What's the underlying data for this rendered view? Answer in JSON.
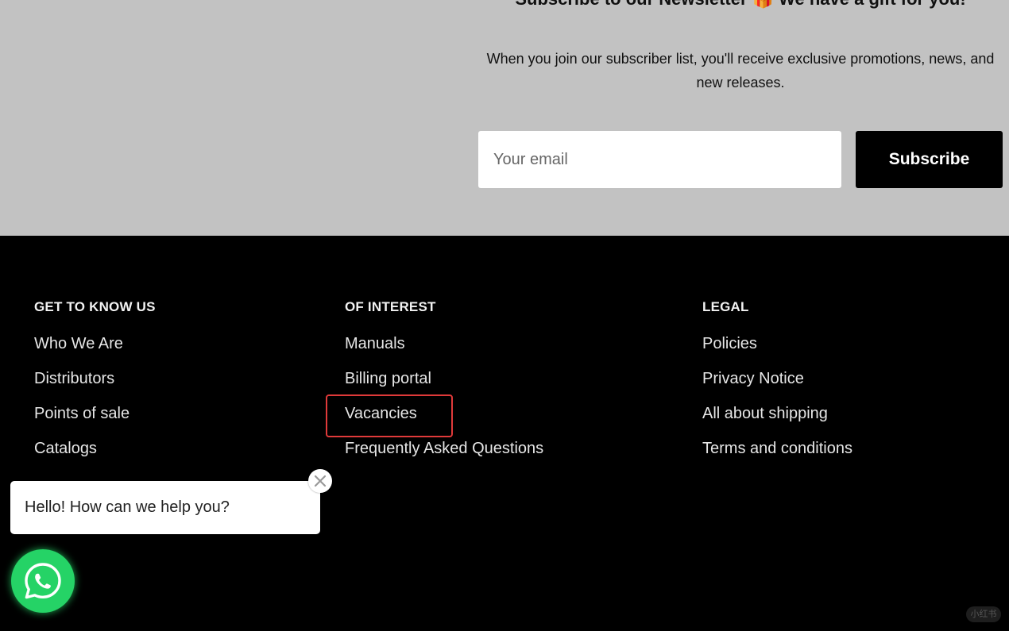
{
  "newsletter": {
    "heading": "Subscribe to our Newsletter 🎁 We have a gift for you!",
    "description": "When you join our subscriber list, you'll receive exclusive promotions, news, and new releases.",
    "email_placeholder": "Your email",
    "subscribe_label": "Subscribe",
    "background_color": "#c2c2c2"
  },
  "footer": {
    "columns": [
      {
        "heading": "GET TO KNOW US",
        "links": [
          "Who We Are",
          "Distributors",
          "Points of sale",
          "Catalogs"
        ]
      },
      {
        "heading": "OF INTEREST",
        "links": [
          "Manuals",
          "Billing portal",
          "Vacancies",
          "Frequently Asked Questions"
        ]
      },
      {
        "heading": "LEGAL",
        "links": [
          "Policies",
          "Privacy Notice",
          "All about shipping",
          "Terms and conditions"
        ]
      }
    ],
    "highlighted_link": "Vacancies",
    "highlight_color": "#e03a3a"
  },
  "chat": {
    "message": "Hello! How can we help you?",
    "close_icon": "close-icon",
    "launcher_icon": "whatsapp-icon",
    "launcher_color": "#25d366"
  },
  "watermark": {
    "text": "小红书"
  }
}
